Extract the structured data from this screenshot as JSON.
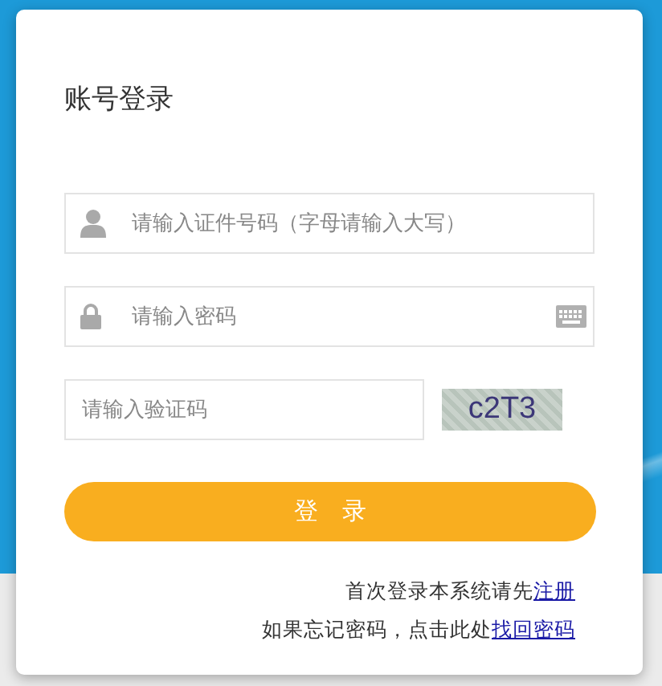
{
  "title": "账号登录",
  "fields": [
    {
      "kind": "user",
      "placeholder": "请输入证件号码（字母请输入大写）"
    },
    {
      "kind": "password",
      "placeholder": "请输入密码"
    }
  ],
  "captcha": {
    "placeholder": "请输入验证码",
    "code": "c2T3"
  },
  "login_button": "登　录",
  "links": [
    {
      "text": "首次登录本系统请先",
      "link": "注册"
    },
    {
      "text": "如果忘记密码，点击此处",
      "link": "找回密码"
    }
  ]
}
